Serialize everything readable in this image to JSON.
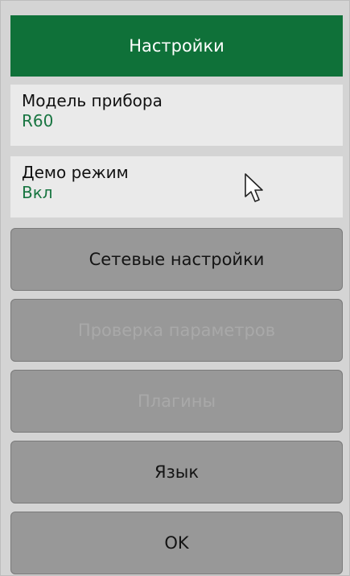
{
  "header": {
    "title": "Настройки"
  },
  "fields": {
    "model": {
      "label": "Модель прибора",
      "value": "R60"
    },
    "demo": {
      "label": "Демо режим",
      "value": "Вкл"
    }
  },
  "buttons": {
    "network": "Сетевые настройки",
    "check_params": "Проверка параметров",
    "plugins": "Плагины",
    "language": "Язык",
    "ok": "OK"
  },
  "icons": {
    "cursor": "mouse-pointer-icon"
  },
  "colors": {
    "header_bg": "#0f7139",
    "value_text": "#187541",
    "button_bg": "#989898",
    "disabled_text": "#a9a9a9"
  }
}
